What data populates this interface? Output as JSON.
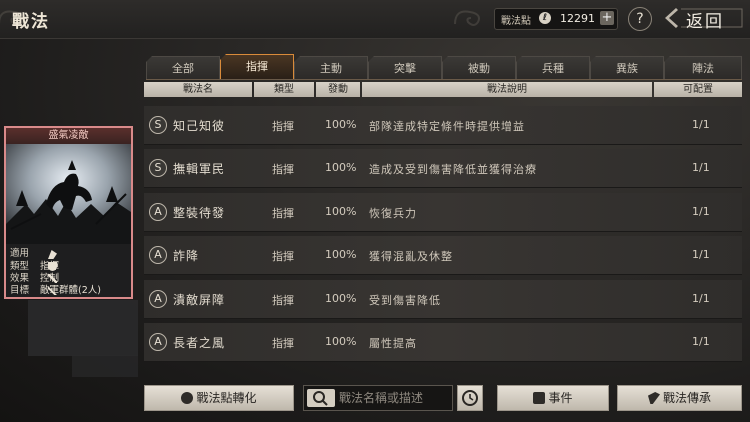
{
  "header": {
    "title": "戰法",
    "points_label": "戰法點",
    "points_value": "12291",
    "help_label": "?",
    "back_label": "返回"
  },
  "tabs": [
    "全部",
    "指揮",
    "主動",
    "突擊",
    "被動",
    "兵種",
    "異族",
    "陣法"
  ],
  "active_tab": "指揮",
  "columns": {
    "name": "戰法名",
    "type": "類型",
    "trigger": "發動",
    "desc": "戰法說明",
    "config": "可配置"
  },
  "rows": [
    {
      "grade": "S",
      "name": "知己知彼",
      "type": "指揮",
      "trigger": "100%",
      "desc": "部隊達成特定條件時提供增益",
      "config": "1/1"
    },
    {
      "grade": "S",
      "name": "撫輯軍民",
      "type": "指揮",
      "trigger": "100%",
      "desc": "造成及受到傷害降低並獲得治療",
      "config": "1/1"
    },
    {
      "grade": "A",
      "name": "整裝待發",
      "type": "指揮",
      "trigger": "100%",
      "desc": "恢復兵力",
      "config": "1/1"
    },
    {
      "grade": "A",
      "name": "詐降",
      "type": "指揮",
      "trigger": "100%",
      "desc": "獲得混亂及休整",
      "config": "1/1"
    },
    {
      "grade": "A",
      "name": "潰敵屏障",
      "type": "指揮",
      "trigger": "100%",
      "desc": "受到傷害降低",
      "config": "1/1"
    },
    {
      "grade": "A",
      "name": "長者之風",
      "type": "指揮",
      "trigger": "100%",
      "desc": "屬性提高",
      "config": "1/1"
    }
  ],
  "card": {
    "title": "盛氣凌敵",
    "apply_key": "適用",
    "type_key": "類型",
    "type_value": "指揮",
    "effect_key": "效果",
    "effect_value": "控制",
    "target_key": "目標",
    "target_value": "敵軍群體(2人)"
  },
  "bottom": {
    "convert_label": "戰法點轉化",
    "search_placeholder": "戰法名稱或描述",
    "event_label": "事件",
    "inherit_label": "戰法傳承"
  },
  "colors": {
    "accent": "#d98b3a",
    "card_border": "#d98a8a"
  }
}
